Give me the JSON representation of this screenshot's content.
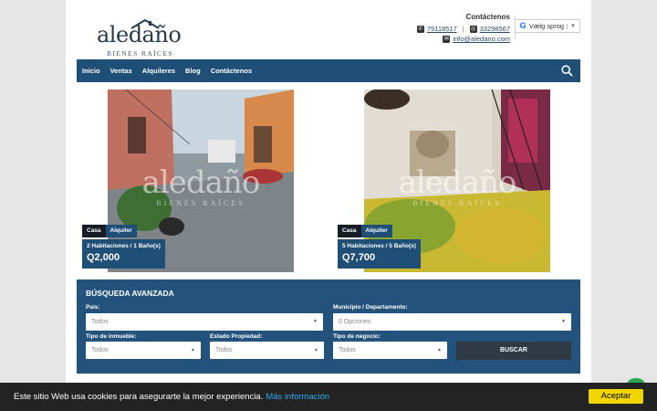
{
  "brand": {
    "name": "aledaño",
    "tagline": "BIENES RAÍCES"
  },
  "contact": {
    "title": "Contáctenos",
    "phone": "79118517",
    "whatsapp": "33298567",
    "email": "info@aledano.com"
  },
  "translate": {
    "label": "Vælg sprog",
    "caret": "▼"
  },
  "nav": {
    "items": [
      "Inicio",
      "Ventas",
      "Alquileres",
      "Blog",
      "Contáctenos"
    ]
  },
  "listings": [
    {
      "type": "Casa",
      "operation": "Alquiler",
      "rooms": "2 Habitaciones / 1 Baño(s)",
      "price": "Q2,000"
    },
    {
      "type": "Casa",
      "operation": "Alquiler",
      "rooms": "5 Habitaciones / 5 Baño(s)",
      "price": "Q7,700"
    }
  ],
  "search": {
    "title": "BÚSQUEDA AVANZADA",
    "country_label": "País:",
    "country_value": "Todos",
    "municipality_label": "Municipio / Departamento:",
    "municipality_value": "0 Opciones",
    "property_type_label": "Tipo de inmueble:",
    "property_type_value": "Todos",
    "property_state_label": "Estado Propiedad:",
    "property_state_value": "Todos",
    "business_type_label": "Tipo de negocio:",
    "business_type_value": "Todos",
    "button": "BUSCAR"
  },
  "cookie": {
    "text": "Este sitio Web usa cookies para asegurarte la mejor experiencia.",
    "link": "Más información",
    "button": "Aceptar"
  },
  "colors": {
    "nav": "#1f4e77",
    "panel": "#23527c",
    "accept": "#f1d600"
  },
  "icons": [
    "phone-icon",
    "whatsapp-icon",
    "mail-icon",
    "google-icon",
    "search-icon",
    "chat-icon"
  ]
}
